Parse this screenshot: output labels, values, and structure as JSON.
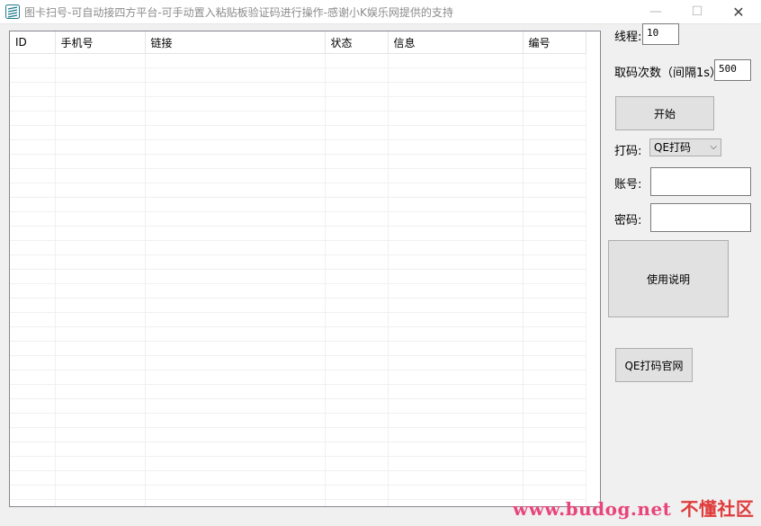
{
  "window": {
    "title": "图卡扫号-可自动接四方平台-可手动置入粘贴板验证码进行操作-感谢小K娱乐网提供的支持",
    "minimize": "—",
    "maximize": "☐",
    "close": "✕"
  },
  "grid": {
    "columns": [
      "ID",
      "手机号",
      "链接",
      "状态",
      "信息",
      "编号"
    ]
  },
  "controls": {
    "threads_label": "线程:",
    "threads_value": "10",
    "fetch_label": "取码次数（间隔1s）",
    "fetch_value": "500",
    "start_button": "开始",
    "captcha_label": "打码:",
    "captcha_selected": "QE打码",
    "account_label": "账号:",
    "account_value": "",
    "password_label": "密码:",
    "password_value": "",
    "help_button": "使用说明",
    "site_button": "QE打码官网"
  },
  "watermark": {
    "url": "www.budog.net",
    "cn": "不懂社区"
  }
}
